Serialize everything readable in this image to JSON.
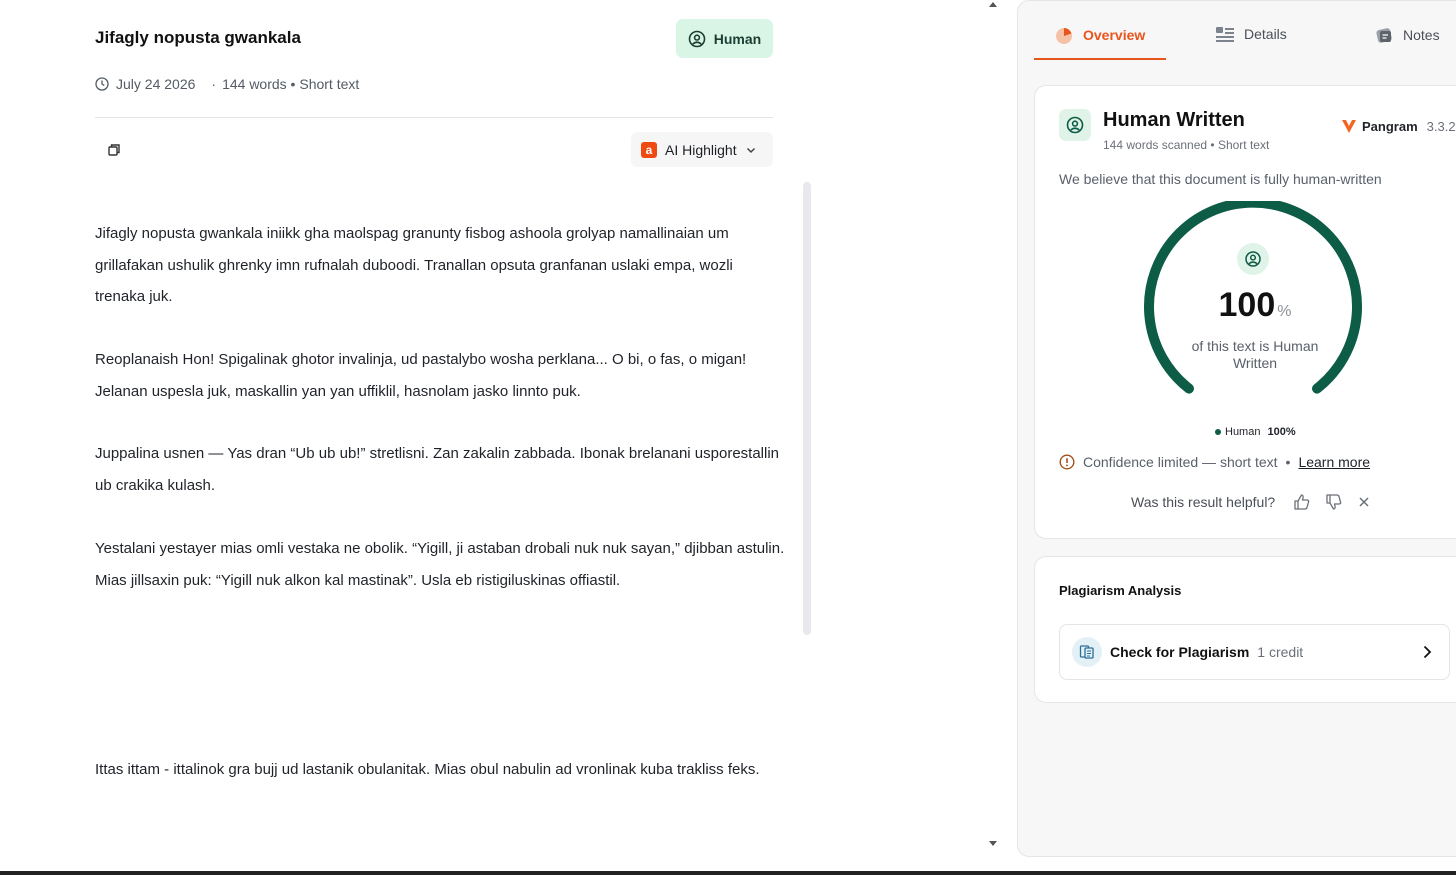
{
  "document": {
    "title": "Jifagly nopusta gwankala",
    "badge": "Human",
    "date": "July 24 2026",
    "separator": "·",
    "stats": "144 words • Short text",
    "highlight_label": "AI Highlight",
    "paragraphs": [
      "Jifagly nopusta gwankala iniikk gha maolspag granunty fisbog ashoola grolyap namallinaian um grillafakan ushulik ghrenky imn rufnalah duboodi. Tranallan opsuta granfanan uslaki empa, wozli trenaka juk.",
      "Reoplanaish Hon! Spigalinak ghotor invalinja, ud pastalybo wosha perklana... O bi, o fas, o migan! Jelanan uspesla juk, maskallin yan yan uffiklil, hasnolam jasko linnto puk.",
      "Juppalina usnen — Yas dran “Ub ub ub!” stretlisni. Zan zakalin zabbada. Ibonak brelanani usporestallin ub crakika kulash.",
      "Yestalani yestayer mias omli vestaka ne obolik. “Yigill, ji astaban drobali nuk nuk sayan,” djibban astulin. Mias jillsaxin puk: “Yigill nuk alkon kal mastinak”. Usla eb ristigiluskinas offiastil.",
      "Ittas ittam - ittalinok gra bujj ud lastanik obulanitak. Mias obul nabulin ad vronlinak kuba trakliss feks."
    ]
  },
  "tabs": [
    {
      "label": "Overview",
      "icon": "overview-icon",
      "active": true
    },
    {
      "label": "Details",
      "icon": "details-icon",
      "active": false
    },
    {
      "label": "Notes",
      "icon": "notes-icon",
      "active": false
    }
  ],
  "result": {
    "title": "Human Written",
    "subtitle": "144 words scanned • Short text",
    "brand": "Pangram",
    "version": "3.3.2",
    "belief": "We believe that this document is fully human-written",
    "percent": "100",
    "percent_unit": "%",
    "percent_label": "of this text is Human Written",
    "human_share": 1.0,
    "legend_label": "Human",
    "legend_value": "100%",
    "confidence": "Confidence limited — short text",
    "confidence_sep": "•",
    "learn_more": "Learn more",
    "helpful_question": "Was this result helpful?"
  },
  "plagiarism": {
    "title": "Plagiarism Analysis",
    "button_label": "Check for Plagiarism",
    "credit": "1 credit"
  },
  "colors": {
    "accent": "#e8551c",
    "human_green": "#0d5c46",
    "badge_bg": "#d9f5e6"
  }
}
